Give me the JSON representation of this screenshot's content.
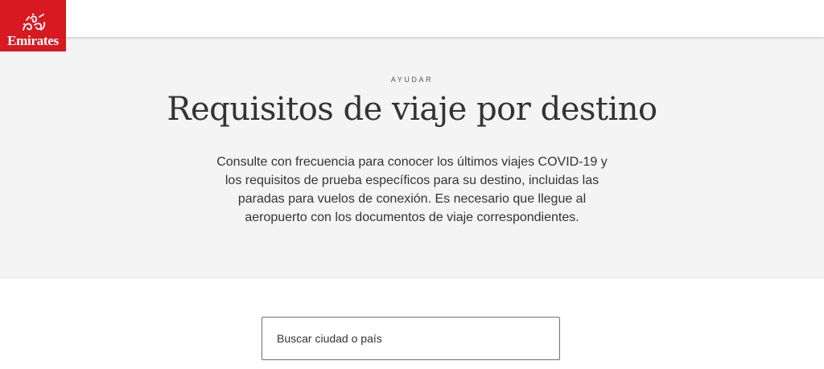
{
  "brand": {
    "name": "Emirates",
    "color": "#d71921"
  },
  "hero": {
    "eyebrow": "AYUDAR",
    "title": "Requisitos de viaje por destino",
    "description": "Consulte con frecuencia para conocer los últimos viajes COVID-19 y los requisitos de prueba específicos para su destino, incluidas las paradas para vuelos de conexión. Es necesario que llegue al aeropuerto con los documentos de viaje correspondientes."
  },
  "search": {
    "placeholder": "Buscar ciudad o país",
    "value": ""
  }
}
